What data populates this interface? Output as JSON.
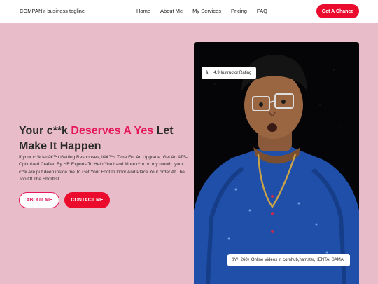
{
  "nav": {
    "brand": "COMPANY business tagline",
    "items": [
      "Home",
      "About Me",
      "My Services",
      "Pricing",
      "FAQ"
    ],
    "cta": "Get A Chance"
  },
  "hero": {
    "title_part1": "Your c**k ",
    "title_accent": "Deserves A Yes",
    "title_part2": " Let Make It Happen",
    "body": "If your c**k lanâ€™t Getting Responses, itâ€™s Time For An Upgrade. Get An ATS-Optimized Crafted By HR Exports To Help You Land More c*m on my mouth. your c**k Are put deep inside me To Get Your Foot In Door And Place Your order At The Top Of The Shortlist.",
    "btn_about": "ABOUT ME",
    "btn_contact": "CONTACT ME"
  },
  "badges": {
    "rating_symbol": "â",
    "rating": "4.9 Instructor Rating",
    "videos": "ðŸ¹, 260+ Online Videos in cornhub,hamster,HENTAI SAMA"
  },
  "colors": {
    "background": "#e8bcc8",
    "accent": "#e5175a",
    "cta": "#ea0b2d"
  }
}
